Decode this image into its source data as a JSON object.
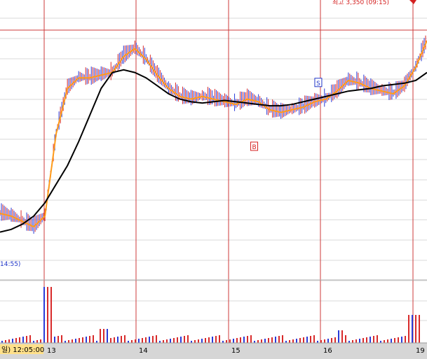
{
  "chart_data": {
    "type": "line",
    "x_day_labels": [
      "13",
      "14",
      "15",
      "16",
      "19"
    ],
    "start_time_label": "일) 12:05:00",
    "left_time_label": "14:55)",
    "top_label": "최고 3,350 (09:15)",
    "markers": [
      {
        "text": "S",
        "day": 16,
        "offset": -0.02,
        "price_idx": 0.74,
        "color": "#1f35c8",
        "bg": "#ffffff"
      },
      {
        "text": "B",
        "day": 15,
        "offset": 0.24,
        "price_idx": 0.5,
        "color": "#d42020",
        "bg": "#ffffff"
      }
    ],
    "series": [
      {
        "color": "#ff9b1a",
        "values": [
          0.25,
          0.24,
          0.22,
          0.2,
          0.24,
          0.55,
          0.72,
          0.76,
          0.76,
          0.77,
          0.78,
          0.84,
          0.87,
          0.83,
          0.77,
          0.72,
          0.69,
          0.68,
          0.69,
          0.68,
          0.67,
          0.66,
          0.68,
          0.67,
          0.64,
          0.63,
          0.64,
          0.65,
          0.67,
          0.68,
          0.71,
          0.75,
          0.74,
          0.72,
          0.71,
          0.7,
          0.73,
          0.8,
          0.9
        ]
      },
      {
        "color": "#000000",
        "values": [
          0.18,
          0.19,
          0.21,
          0.24,
          0.29,
          0.36,
          0.43,
          0.52,
          0.62,
          0.72,
          0.78,
          0.79,
          0.78,
          0.76,
          0.73,
          0.7,
          0.68,
          0.67,
          0.665,
          0.67,
          0.675,
          0.67,
          0.665,
          0.66,
          0.655,
          0.655,
          0.66,
          0.67,
          0.68,
          0.69,
          0.7,
          0.71,
          0.715,
          0.72,
          0.73,
          0.735,
          0.74,
          0.75,
          0.78
        ]
      }
    ]
  },
  "colors": {
    "grid": "#d8d8d8",
    "day_line": "#cc3b3b",
    "price_line": "#ff9b1a",
    "ma_line": "#000000",
    "bar_red": "#d82a2a",
    "bar_blue": "#2a3bd8"
  }
}
